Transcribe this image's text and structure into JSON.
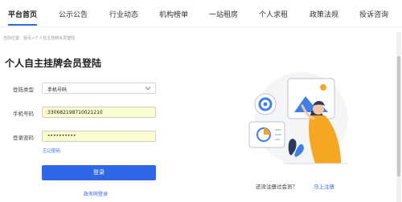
{
  "nav": {
    "items": [
      "平台首页",
      "公示公告",
      "行业动态",
      "机构榜单",
      "一站租房",
      "个人求租",
      "政策法规",
      "投诉咨询"
    ]
  },
  "breadcrumb": "当前位置：首页>个人自主挂牌会员登陆",
  "page_title": "个人自主挂牌会员登陆",
  "form": {
    "login_type_label": "登陆类型",
    "login_type_value": "手机号码",
    "phone_label": "手机号码",
    "phone_value": "330682198710021210",
    "password_label": "登录密码",
    "password_value": "••••••••••",
    "forgot_label": "忘记密码",
    "login_button": "登录",
    "gov_login_link": "政务网登录"
  },
  "register": {
    "prompt": "还没注册过会员？",
    "link": "马上注册"
  },
  "colors": {
    "accent": "#2e68e6",
    "autofill": "#fbfbd0",
    "illustration_orange": "#f5a623",
    "illustration_blue": "#3f7fe6"
  },
  "icons": [
    "chevron-down-icon",
    "login-illustration"
  ]
}
